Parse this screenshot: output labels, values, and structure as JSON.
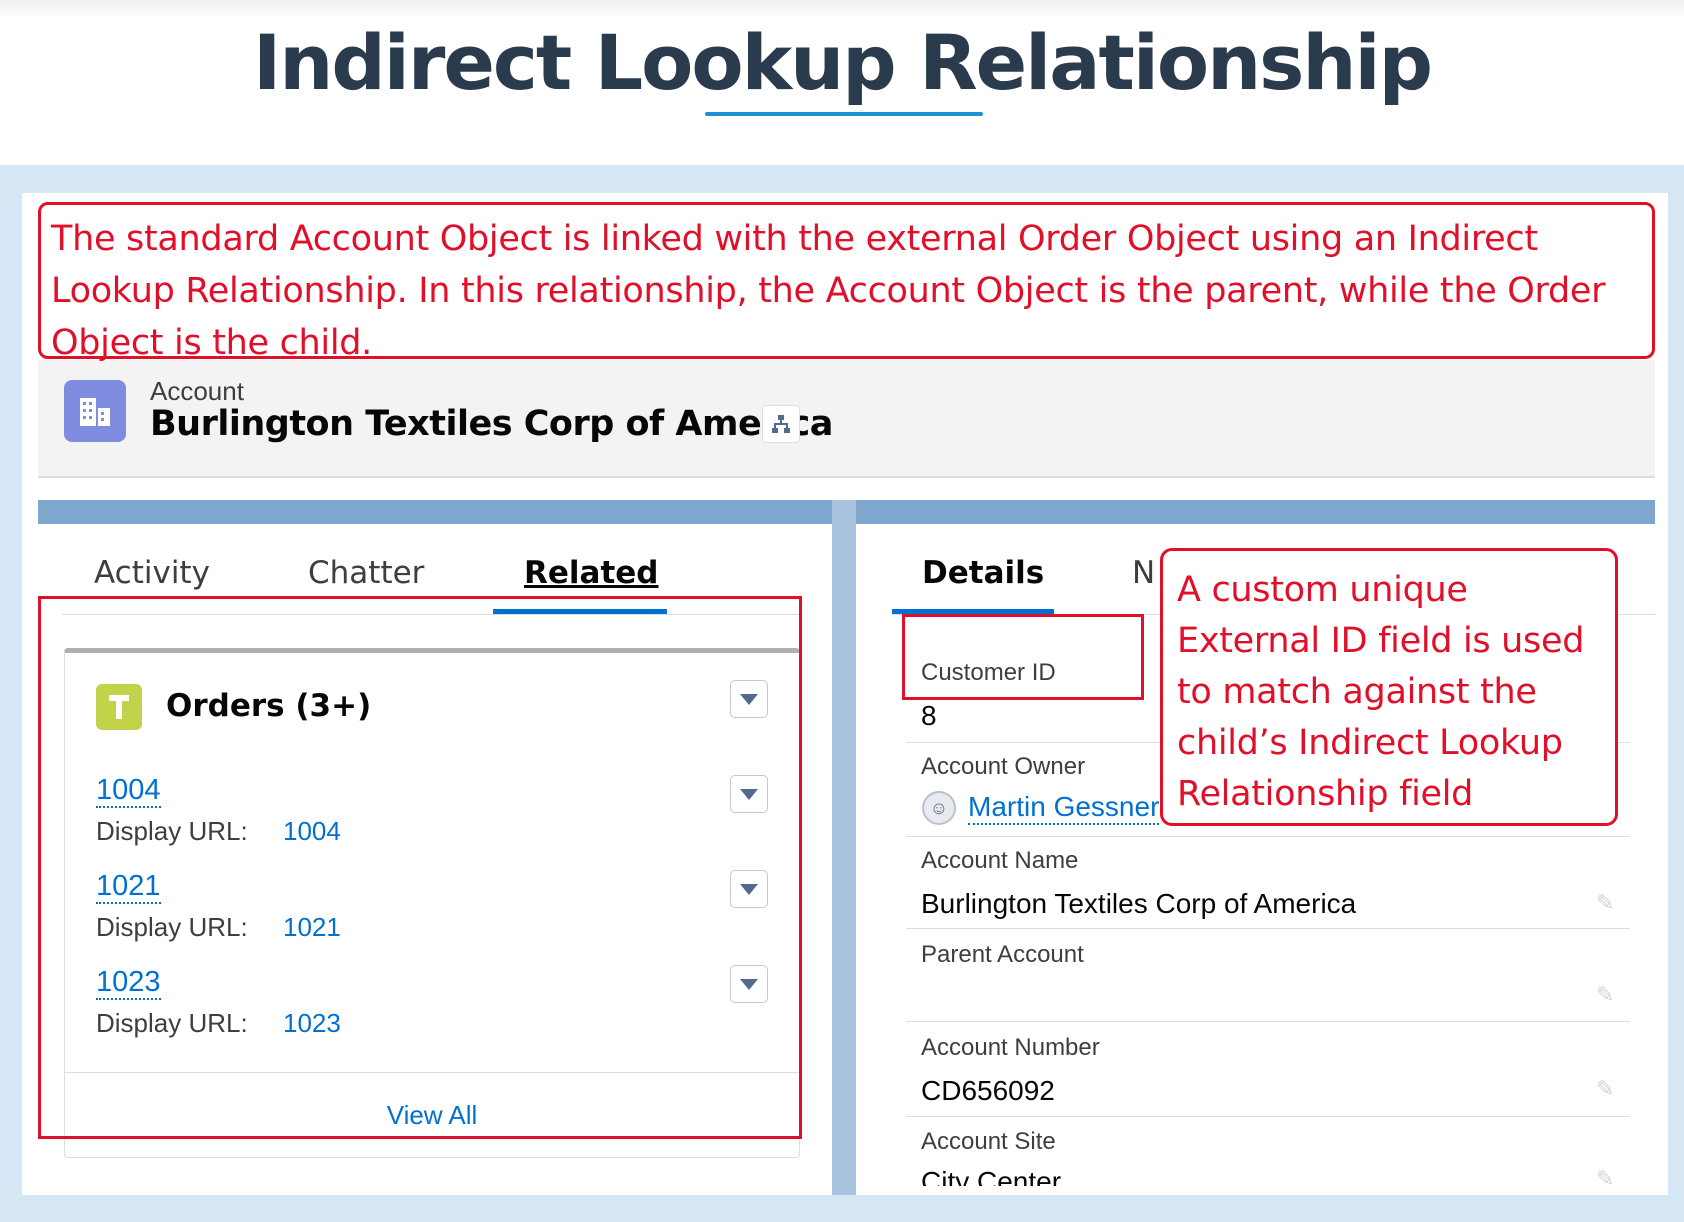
{
  "heading": "Indirect Lookup Relationship",
  "annotations": {
    "top": "The standard Account Object is linked with the external Order Object using an Indirect Lookup Relationship. In this relationship, the Account Object is the parent, while the Order Object is the child.",
    "right": "A custom unique External ID field is used to match against the child’s Indirect Lookup Relationship field"
  },
  "record": {
    "object_label": "Account",
    "name": "Burlington Textiles Corp of America",
    "icon": "building-icon",
    "hierarchy_icon": "hierarchy-icon"
  },
  "left_tabs": [
    "Activity",
    "Chatter",
    "Related"
  ],
  "right_tabs": [
    "Details",
    "N"
  ],
  "orders_card": {
    "title": "Orders (3+)",
    "icon": "order-icon",
    "items": [
      {
        "id": "1004",
        "url_label": "Display URL:",
        "url": "1004"
      },
      {
        "id": "1021",
        "url_label": "Display URL:",
        "url": "1021"
      },
      {
        "id": "1023",
        "url_label": "Display URL:",
        "url": "1023"
      }
    ],
    "view_all": "View All"
  },
  "details": {
    "customer_id_label": "Customer ID",
    "customer_id_value": "8",
    "owner_label": "Account Owner",
    "owner_value": "Martin Gessner",
    "name_label": "Account Name",
    "name_value": "Burlington Textiles Corp of America",
    "parent_label": "Parent Account",
    "parent_value": "",
    "number_label": "Account Number",
    "number_value": "CD656092",
    "site_label": "Account Site",
    "site_value": "City Center"
  },
  "colors": {
    "annotation_red": "#e0102a",
    "link_blue": "#0070d2",
    "title_navy": "#2a3b4e",
    "accent_underline": "#1e90d6",
    "frame_blue": "#d5e6f4"
  }
}
